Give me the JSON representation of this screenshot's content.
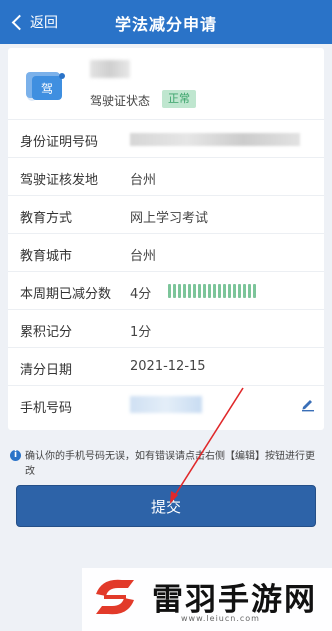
{
  "header": {
    "back_label": "返回",
    "title": "学法减分申请"
  },
  "profile": {
    "status_label": "驾驶证状态",
    "status_badge": "正常",
    "icon_char": "驾"
  },
  "rows": [
    {
      "label": "身份证明号码",
      "value": ""
    },
    {
      "label": "驾驶证核发地",
      "value": "台州"
    },
    {
      "label": "教育方式",
      "value": "网上学习考试"
    },
    {
      "label": "教育城市",
      "value": "台州"
    },
    {
      "label": "本周期已减分数",
      "value": "4分",
      "progress": 1.0
    },
    {
      "label": "累积记分",
      "value": "1分"
    },
    {
      "label": "清分日期",
      "value": "2021-12-15"
    },
    {
      "label": "手机号码",
      "value": ""
    }
  ],
  "note": "确认你的手机号码无误，如有错误请点击右侧【编辑】按钮进行更改",
  "submit_label": "提交",
  "watermark": {
    "title": "雷羽手游网",
    "url": "www.leiucn.com"
  },
  "colors": {
    "header": "#2a73c8",
    "submit": "#2d63a8",
    "badge_bg": "#bfe6cf",
    "badge_text": "#3aa36a",
    "arrow": "#e0282a"
  }
}
